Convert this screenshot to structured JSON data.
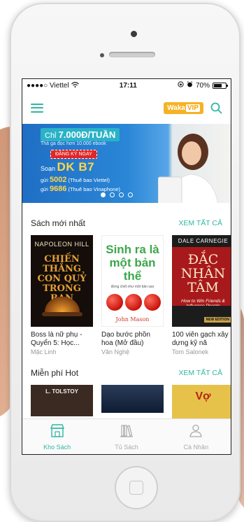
{
  "status_bar": {
    "carrier": "●●●●○ Viettel",
    "time": "17:11",
    "battery": "70%"
  },
  "app_bar": {
    "logo_text": "Waka",
    "logo_badge": "VIP"
  },
  "banner": {
    "price_prefix": "Chỉ",
    "price": "7.000Đ/TUẦN",
    "subtitle": "Thả ga đọc hơn 10.000 ebook",
    "cta": "ĐĂNG KÝ NGAY",
    "sms_prefix": "Soạn",
    "sms_code": "DK B7",
    "line1_prefix": "gửi",
    "line1_number": "5002",
    "line1_suffix": "(Thuê bao Viettel)",
    "line2_prefix": "gửi",
    "line2_number": "9686",
    "line2_suffix": "(Thuê bao Vinaphone)",
    "active_dot": 0,
    "dot_count": 4
  },
  "sections": [
    {
      "title": "Sách mới nhất",
      "see_all": "XEM TẤT CẢ",
      "books": [
        {
          "title": "Boss là nữ phụ - Quyển 5: Học...",
          "author": "Mặc Linh",
          "cover_author": "NAPOLEON HILL",
          "cover_title": "CHIẾN THẮNG CON QUỶ TRONG BẠN"
        },
        {
          "title": "Dạo bước phồn hoa (Mở đầu)",
          "author": "Văn Nghệ",
          "cover_title": "Sinh ra là một bản thể",
          "cover_subtitle": "đừng chết như một bản sao",
          "cover_author": "John Mason"
        },
        {
          "title": "100 viên gạch xây dựng kỹ nă",
          "author": "Tom Salonek",
          "cover_author": "DALE CARNEGIE",
          "cover_title": "ĐẮC NHÂN TÂM",
          "cover_subtitle": "How to Win Friends & Influence People",
          "cover_badge": "NEW EDITION"
        }
      ]
    },
    {
      "title": "Miễn phí Hot",
      "see_all": "XEM TẤT CẢ",
      "books": [
        {
          "cover_author": "L. TOLSTOY"
        },
        {},
        {
          "cover_title": "Vợ"
        }
      ]
    }
  ],
  "tabs": [
    {
      "label": "Kho Sách",
      "icon": "store-icon",
      "active": true
    },
    {
      "label": "Tủ Sách",
      "icon": "bookshelf-icon",
      "active": false
    },
    {
      "label": "Cá Nhân",
      "icon": "user-icon",
      "active": false
    }
  ],
  "colors": {
    "accent": "#2fb7a3",
    "vip": "#f5b324",
    "banner_blue": "#1f6fc4"
  }
}
